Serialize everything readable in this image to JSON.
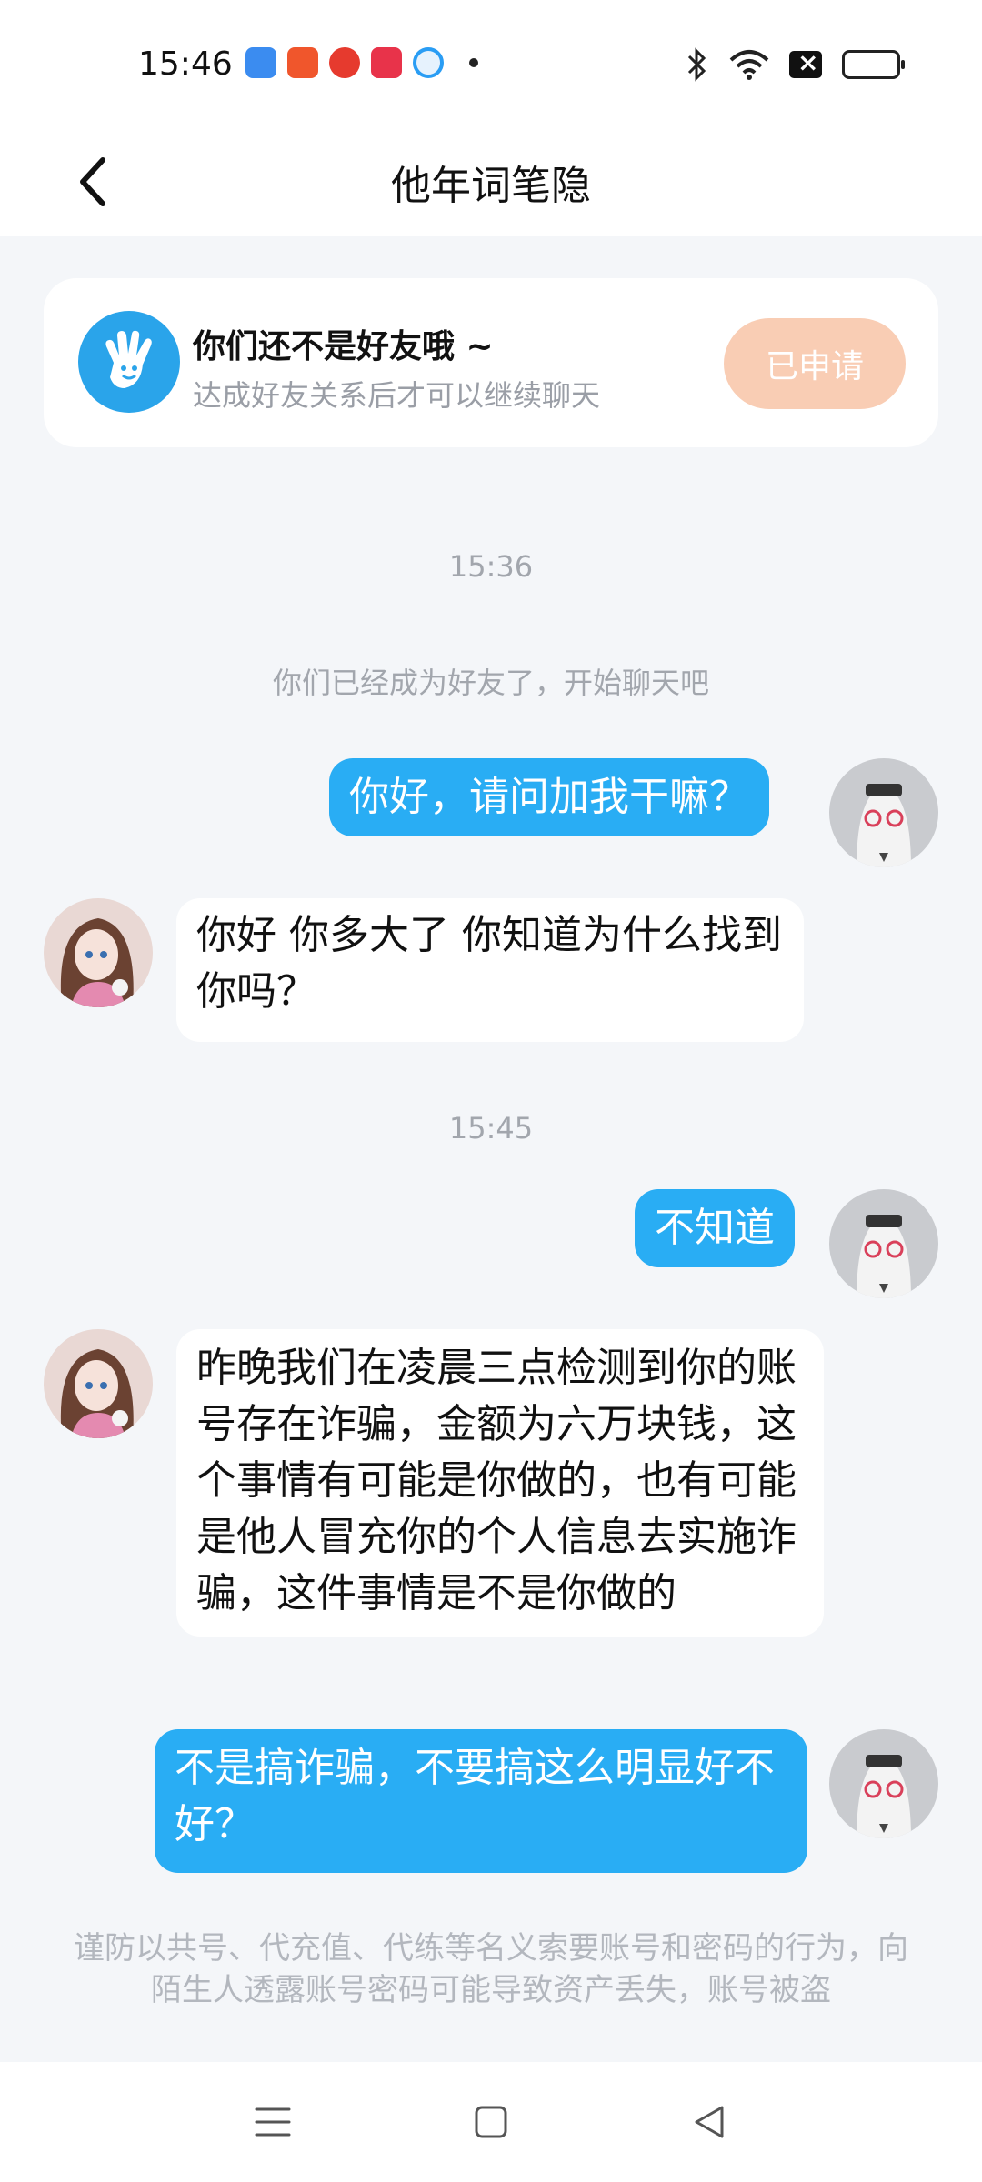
{
  "status_bar": {
    "time": "15:46",
    "notification_icons": [
      {
        "name": "app-blue-icon",
        "color": "#3b8cf0"
      },
      {
        "name": "app-orange-icon",
        "color": "#f0562c"
      },
      {
        "name": "app-red-face-icon",
        "color": "#e63a2e"
      },
      {
        "name": "app-video-icon",
        "color": "#e8334a"
      },
      {
        "name": "app-browser-icon",
        "color": "#2a9df4"
      }
    ]
  },
  "header": {
    "title": "他年词笔隐"
  },
  "friend_banner": {
    "title": "你们还不是好友哦 ~",
    "subtitle": "达成好友关系后才可以继续聊天",
    "button_label": "已申请"
  },
  "chat": {
    "timestamps": [
      "15:36",
      "15:45"
    ],
    "system_message": "你们已经成为好友了，开始聊天吧",
    "messages": [
      {
        "sender": "me",
        "text": "你好，请问加我干嘛？"
      },
      {
        "sender": "other",
        "text": "你好 你多大了 你知道为什么找到你吗？"
      },
      {
        "sender": "me",
        "text": "不知道"
      },
      {
        "sender": "other",
        "text": "昨晚我们在凌晨三点检测到你的账号存在诈骗，金额为六万块钱，这个事情有可能是你做的，也有可能是他人冒充你的个人信息去实施诈骗，这件事情是不是你做的"
      },
      {
        "sender": "me",
        "text": "不是搞诈骗，不要搞这么明显好不好？"
      }
    ],
    "disclaimer": "谨防以共号、代充值、代练等名义索要账号和密码的行为，向陌生人透露账号密码可能导致资产丢失，账号被盗"
  },
  "colors": {
    "accent": "#29adf4",
    "applied_button": "#f9cdb4",
    "background": "#f4f6f9"
  }
}
